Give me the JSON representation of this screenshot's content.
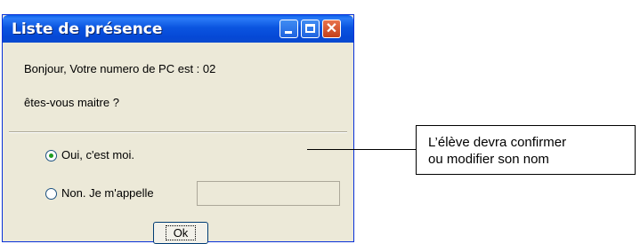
{
  "window": {
    "title": "Liste de présence",
    "greeting": "Bonjour, Votre numero de PC est : 02",
    "question": "êtes-vous maitre ?",
    "options": [
      {
        "label": "Oui, c'est moi.",
        "checked": true
      },
      {
        "label": "Non. Je m'appelle",
        "checked": false
      }
    ],
    "name_field": {
      "value": "",
      "placeholder": ""
    },
    "ok_label": "Ok",
    "controls": {
      "minimize_icon": "minimize-icon",
      "maximize_icon": "maximize-icon",
      "close_icon": "close-icon",
      "close_glyph": "✕"
    }
  },
  "annotation": {
    "line1": "L’élève devra confirmer",
    "line2": "ou modifier son nom"
  }
}
